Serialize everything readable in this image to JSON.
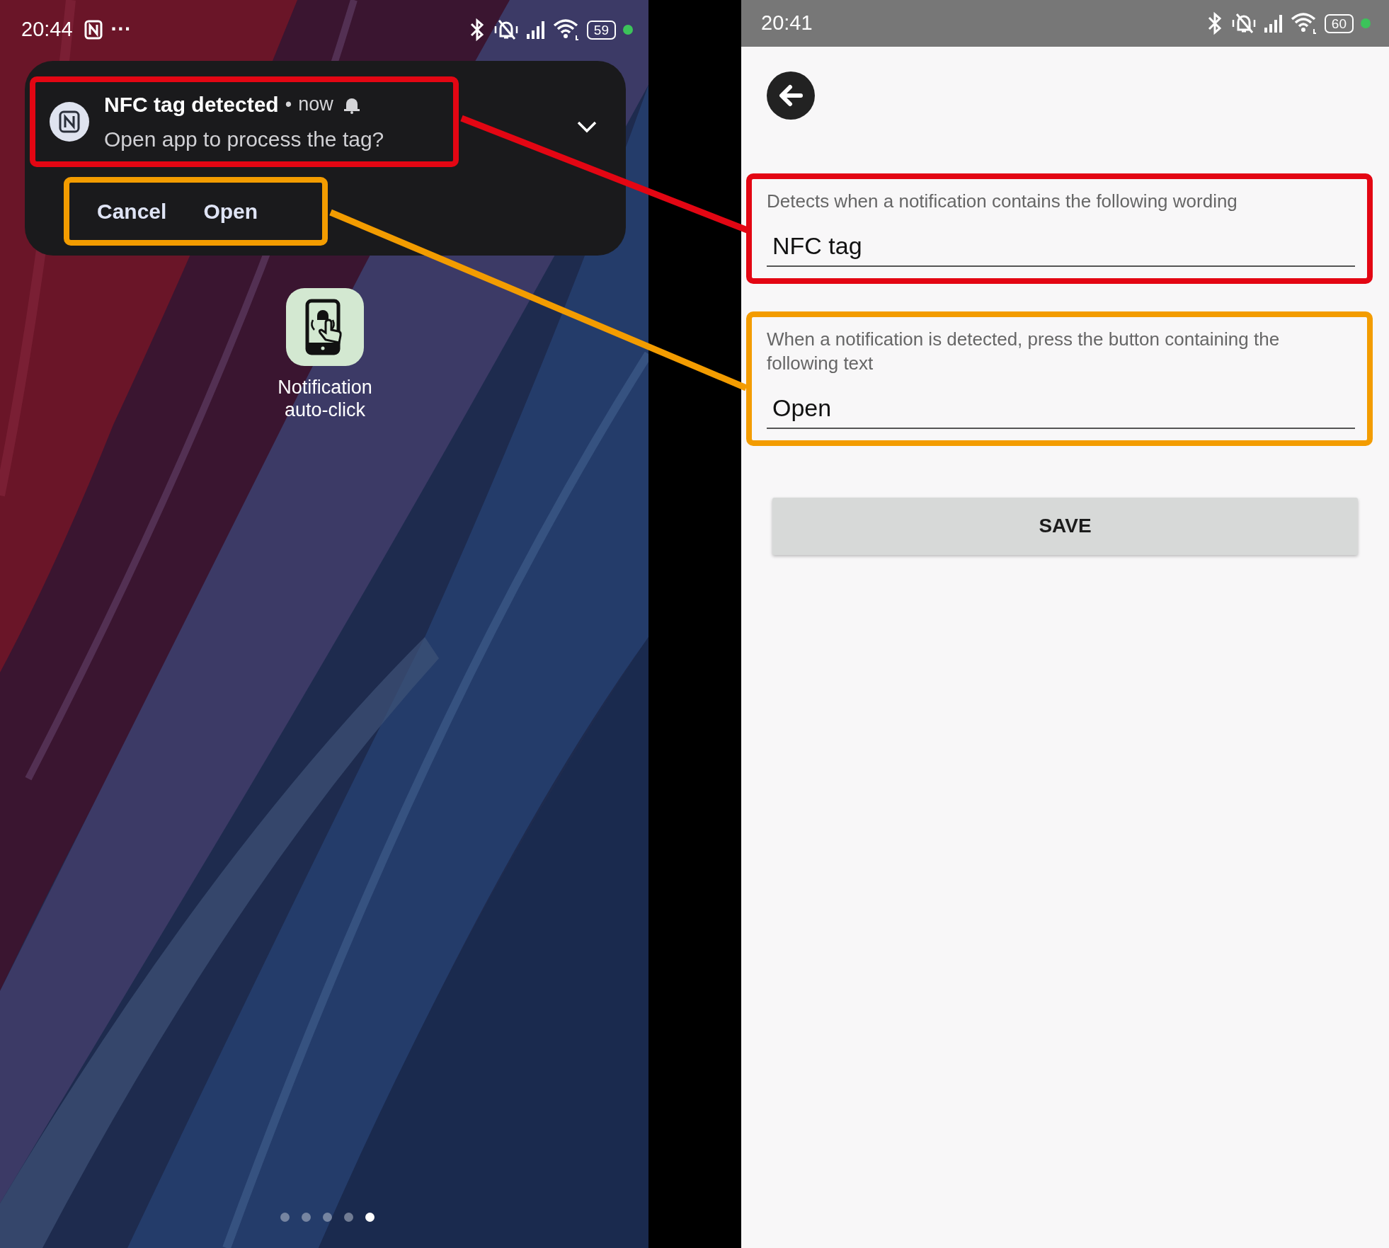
{
  "left_screen": {
    "status_bar": {
      "time": "20:44",
      "more": "···",
      "battery": "59"
    },
    "notification": {
      "title": "NFC tag detected",
      "separator": "•",
      "time": "now",
      "body": "Open app to process the tag?",
      "actions": [
        "Cancel",
        "Open"
      ]
    },
    "app_shortcut": {
      "label": "Notification auto-click"
    },
    "page_dots": [
      {
        "selected": false
      },
      {
        "selected": false
      },
      {
        "selected": false
      },
      {
        "selected": false
      },
      {
        "selected": true
      }
    ]
  },
  "right_screen": {
    "status_bar": {
      "time": "20:41",
      "battery": "60"
    },
    "fields": [
      {
        "label": "Detects when a notification contains the following wording",
        "value": "NFC tag",
        "color": "#e30613"
      },
      {
        "label": "When a notification is detected, press the button containing the following text",
        "value": "Open",
        "color": "#f39c00"
      }
    ],
    "save_button": "SAVE"
  }
}
